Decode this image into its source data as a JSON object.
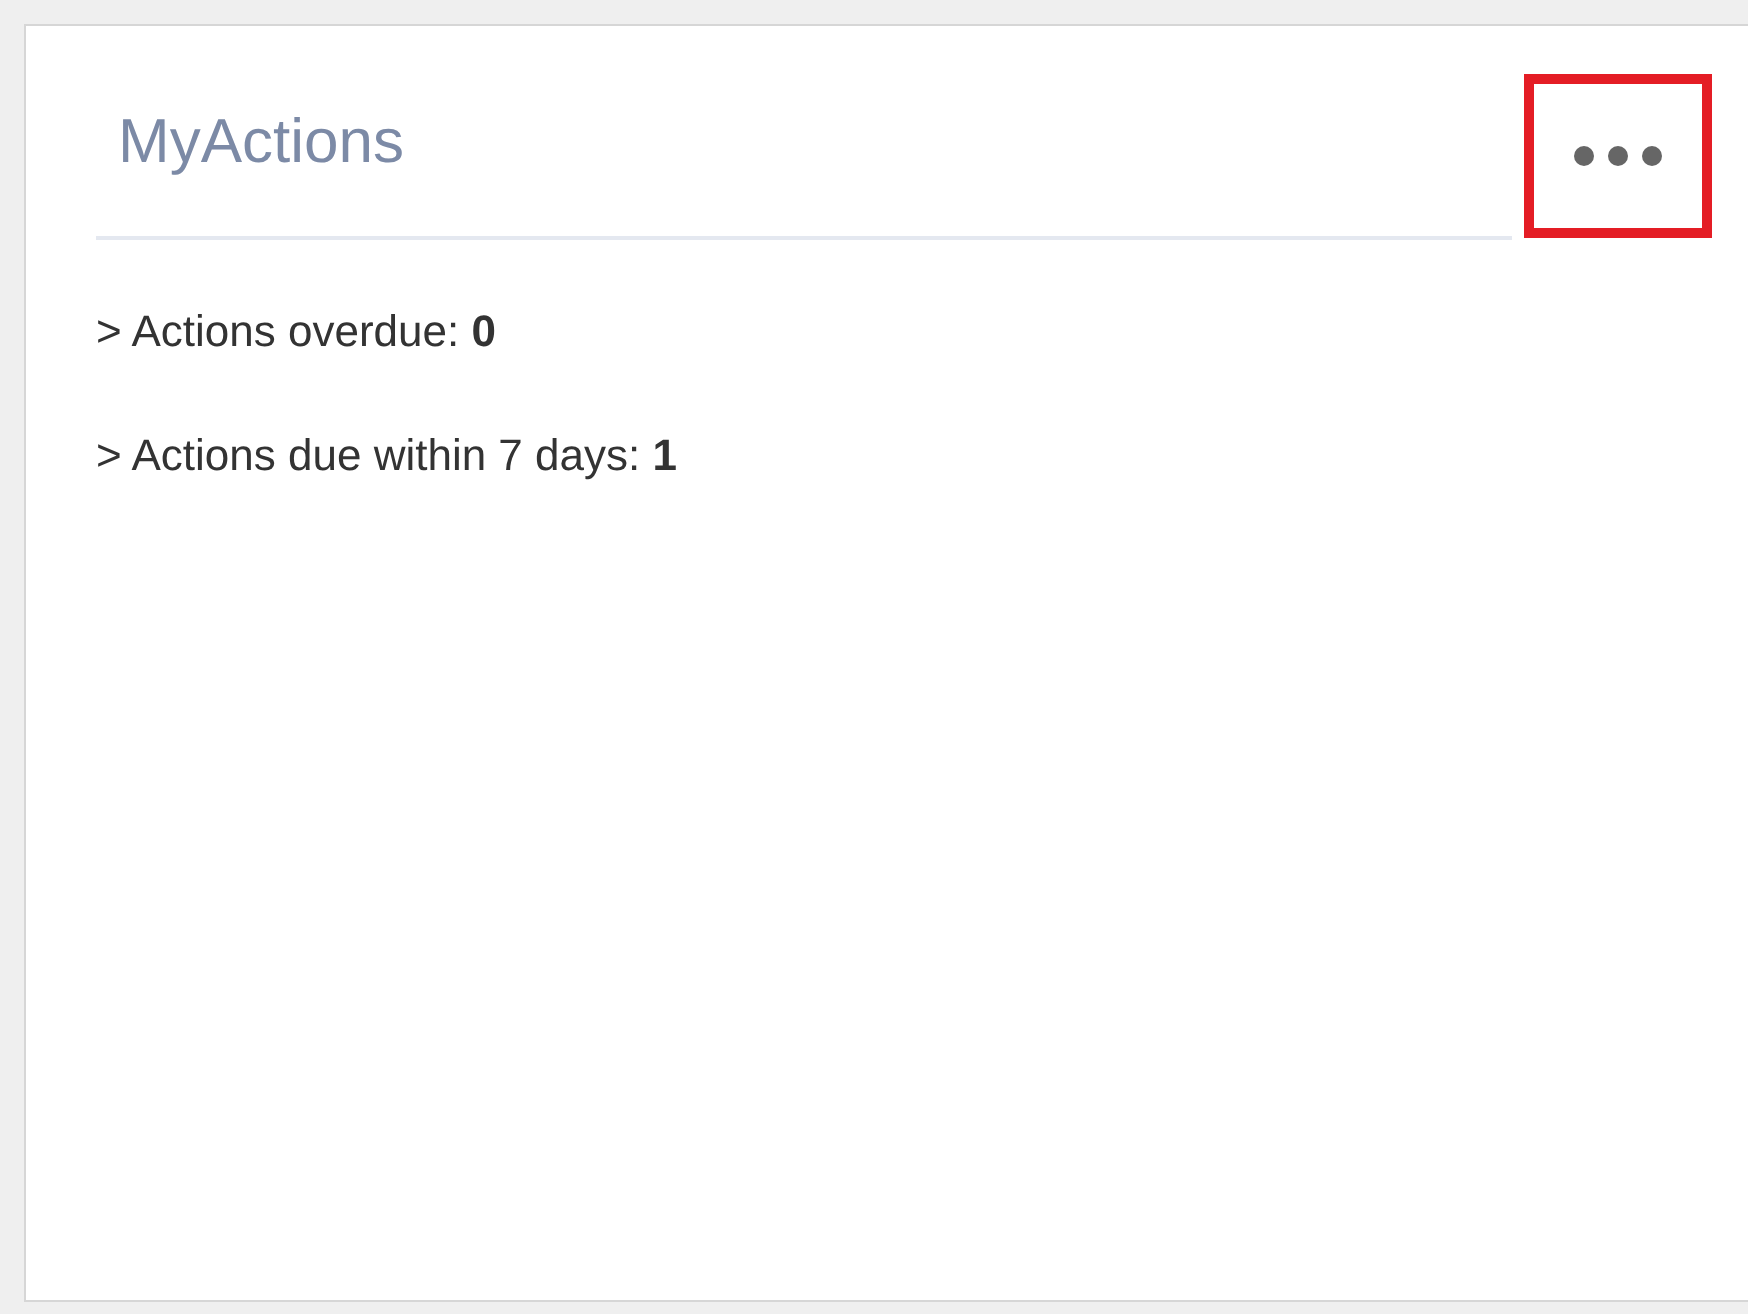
{
  "card": {
    "title": "MyActions",
    "menu_button": {
      "highlighted": true
    },
    "items": [
      "> Actions overdue: **0**",
      "> Actions due within 7 days: **1**"
    ]
  }
}
